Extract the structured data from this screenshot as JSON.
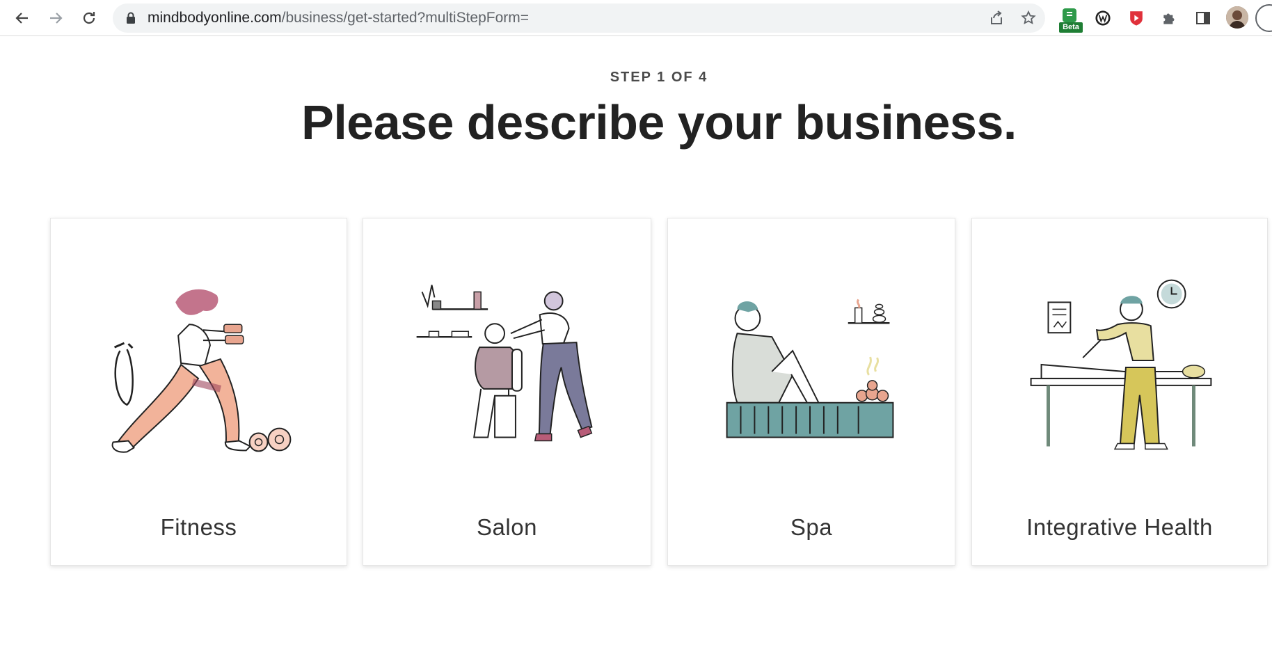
{
  "browser": {
    "url_domain": "mindbodyonline.com",
    "url_path": "/business/get-started?multiStepForm=",
    "extensions": [
      {
        "name": "beta-extension",
        "badge": "Beta"
      },
      {
        "name": "w-extension"
      },
      {
        "name": "red-shield-extension"
      },
      {
        "name": "puzzle-extensions"
      },
      {
        "name": "sidebar-toggle"
      }
    ]
  },
  "page": {
    "step": "STEP 1 OF 4",
    "heading": "Please describe your business.",
    "options": [
      {
        "label": "Fitness",
        "icon": "fitness-illustration"
      },
      {
        "label": "Salon",
        "icon": "salon-illustration"
      },
      {
        "label": "Spa",
        "icon": "spa-illustration"
      },
      {
        "label": "Integrative Health",
        "icon": "integrative-health-illustration"
      }
    ]
  },
  "colors": {
    "accent_peach": "#e8a58f",
    "accent_teal": "#6fa3a3",
    "accent_olive": "#d6c65a",
    "text_dark": "#222222"
  }
}
